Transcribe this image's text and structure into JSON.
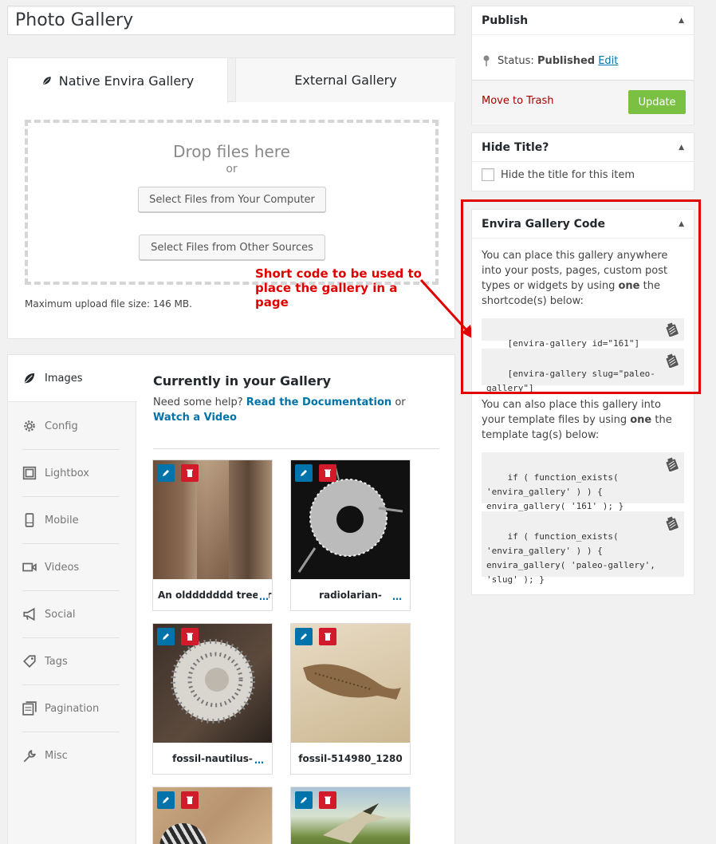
{
  "title_field": {
    "value": "Photo Gallery"
  },
  "uploader": {
    "tabs": [
      {
        "label": "Native Envira Gallery",
        "icon": "leaf-icon"
      },
      {
        "label": "External Gallery"
      }
    ],
    "drop_title": "Drop files here",
    "drop_or": "or",
    "btn_computer": "Select Files from Your Computer",
    "btn_other": "Select Files from Other Sources",
    "max_size": "Maximum upload file size: 146 MB."
  },
  "annotation": "Short code to be used to place the gallery in a page",
  "settings_nav": {
    "items": [
      {
        "label": "Images",
        "icon": "leaf-icon"
      },
      {
        "label": "Config",
        "icon": "gear-icon"
      },
      {
        "label": "Lightbox",
        "icon": "lightbox-icon"
      },
      {
        "label": "Mobile",
        "icon": "mobile-icon"
      },
      {
        "label": "Videos",
        "icon": "video-icon"
      },
      {
        "label": "Social",
        "icon": "megaphone-icon"
      },
      {
        "label": "Tags",
        "icon": "tag-icon"
      },
      {
        "label": "Pagination",
        "icon": "pagination-icon"
      },
      {
        "label": "Misc",
        "icon": "wrench-icon"
      }
    ]
  },
  "gallery": {
    "title": "Currently in your Gallery",
    "help_prefix": "Need some help?",
    "help_link1": "Read the Documentation",
    "help_or": "or",
    "help_link2": "Watch a Video",
    "images": [
      {
        "caption": "An olddddddd tree tru",
        "more": "…"
      },
      {
        "caption": "radiolarian-",
        "more": "…"
      },
      {
        "caption": "fossil-nautilus-",
        "more": "…"
      },
      {
        "caption": "fossil-514980_1280",
        "more": ""
      },
      {
        "caption": "",
        "more": ""
      },
      {
        "caption": "",
        "more": ""
      }
    ]
  },
  "publish": {
    "title": "Publish",
    "status_label": "Status:",
    "status_value": "Published",
    "edit_link": "Edit",
    "trash": "Move to Trash",
    "update": "Update"
  },
  "hide_title": {
    "title": "Hide Title?",
    "checkbox_label": "Hide the title for this item"
  },
  "code_box": {
    "title": "Envira Gallery Code",
    "intro_a": "You can place this gallery anywhere into your posts, pages, custom post types or widgets by using ",
    "intro_one": "one",
    "intro_b": " the shortcode(s) below:",
    "shortcode1": "[envira-gallery id=\"161\"]",
    "shortcode2": "[envira-gallery slug=\"paleo-gallery\"]",
    "tpl_a": "You can also place this gallery into your template files by using ",
    "tpl_one": "one",
    "tpl_b": " the template tag(s) below:",
    "template1": "if ( function_exists( 'envira_gallery' ) ) { envira_gallery( '161' ); }",
    "template2": "if ( function_exists( 'envira_gallery' ) ) { envira_gallery( 'paleo-gallery', 'slug' ); }"
  },
  "colors": {
    "link": "#0073aa",
    "update_green": "#7ac143",
    "annotation_red": "#e00000",
    "delete_red": "#d11a2a"
  }
}
